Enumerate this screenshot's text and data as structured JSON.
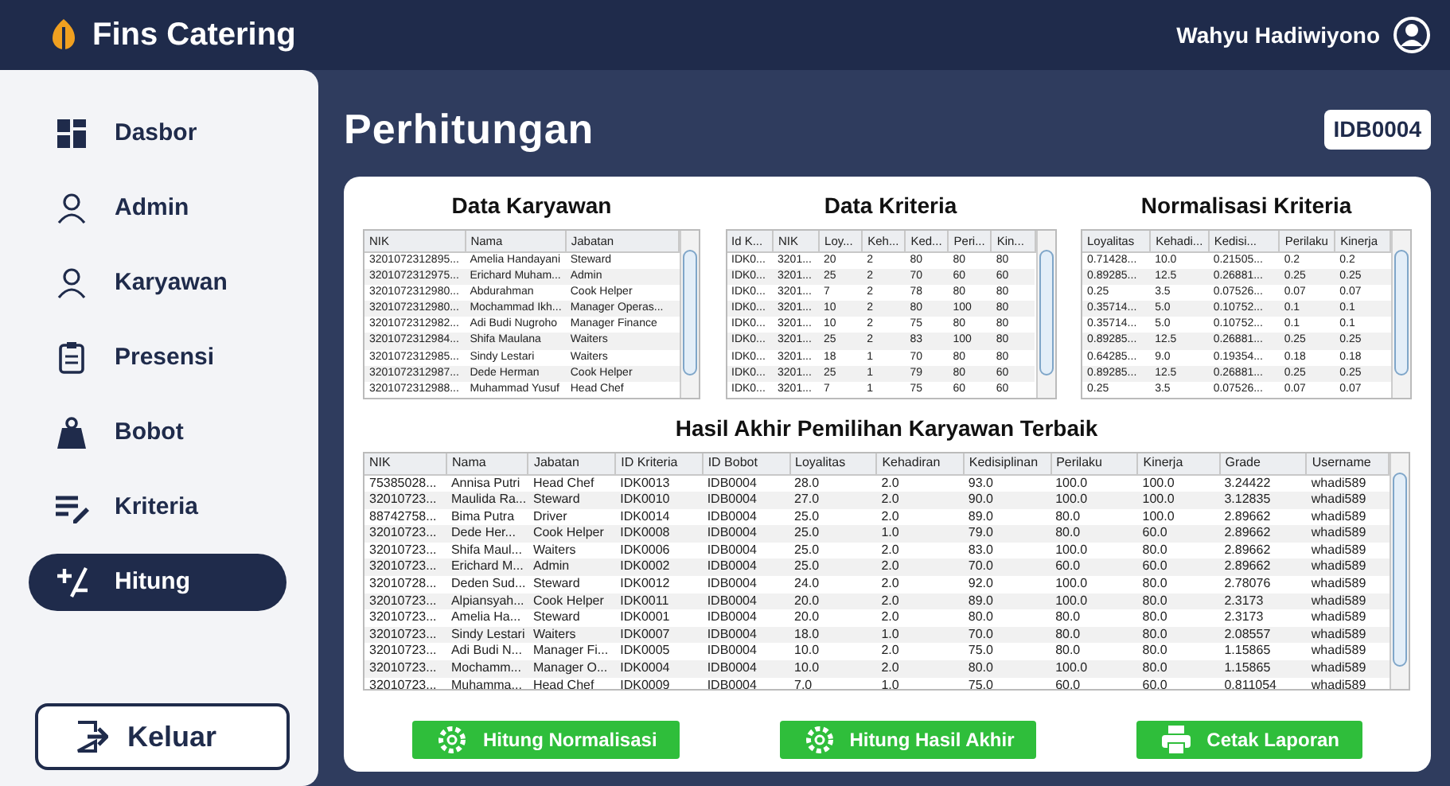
{
  "app": {
    "title": "Fins Catering",
    "user": "Wahyu Hadiwiyono"
  },
  "sidebar": {
    "items": [
      {
        "label": "Dasbor",
        "kind": "dashboard",
        "selected": false
      },
      {
        "label": "Admin",
        "kind": "person",
        "selected": false
      },
      {
        "label": "Karyawan",
        "kind": "person",
        "selected": false
      },
      {
        "label": "Presensi",
        "kind": "clipboard",
        "selected": false
      },
      {
        "label": "Bobot",
        "kind": "weight",
        "selected": false
      },
      {
        "label": "Kriteria",
        "kind": "edit",
        "selected": false
      },
      {
        "label": "Hitung",
        "kind": "calculate",
        "selected": true
      }
    ],
    "logout": "Keluar"
  },
  "page": {
    "title": "Perhitungan",
    "badge": "IDB0004"
  },
  "tables": [
    {
      "title": "Data Karyawan",
      "columns": [
        "NIK",
        "Nama",
        "Jabatan"
      ],
      "rows": [
        [
          "3201072312895...",
          "Amelia Handayani",
          "Steward"
        ],
        [
          "3201072312975...",
          "Erichard Muham...",
          "Admin"
        ],
        [
          "3201072312980...",
          "Abdurahman",
          "Cook Helper"
        ],
        [
          "3201072312980...",
          "Mochammad Ikh...",
          "Manager Operas..."
        ],
        [
          "3201072312982...",
          "Adi Budi Nugroho",
          "Manager Finance"
        ],
        [
          "3201072312984...",
          "Shifa Maulana",
          "Waiters"
        ],
        [
          "3201072312985...",
          "Sindy Lestari",
          "Waiters"
        ],
        [
          "3201072312987...",
          "Dede Herman",
          "Cook Helper"
        ],
        [
          "3201072312988...",
          "Muhammad Yusuf",
          "Head Chef"
        ]
      ]
    },
    {
      "title": "Data Kriteria",
      "columns": [
        "Id K...",
        "NIK",
        "Loy...",
        "Keh...",
        "Ked...",
        "Peri...",
        "Kin..."
      ],
      "rows": [
        [
          "IDK0...",
          "3201...",
          "20",
          "2",
          "80",
          "80",
          "80"
        ],
        [
          "IDK0...",
          "3201...",
          "25",
          "2",
          "70",
          "60",
          "60"
        ],
        [
          "IDK0...",
          "3201...",
          "7",
          "2",
          "78",
          "80",
          "80"
        ],
        [
          "IDK0...",
          "3201...",
          "10",
          "2",
          "80",
          "100",
          "80"
        ],
        [
          "IDK0...",
          "3201...",
          "10",
          "2",
          "75",
          "80",
          "80"
        ],
        [
          "IDK0...",
          "3201...",
          "25",
          "2",
          "83",
          "100",
          "80"
        ],
        [
          "IDK0...",
          "3201...",
          "18",
          "1",
          "70",
          "80",
          "80"
        ],
        [
          "IDK0...",
          "3201...",
          "25",
          "1",
          "79",
          "80",
          "60"
        ],
        [
          "IDK0...",
          "3201...",
          "7",
          "1",
          "75",
          "60",
          "60"
        ]
      ]
    },
    {
      "title": "Normalisasi Kriteria",
      "columns": [
        "Loyalitas",
        "Kehadi...",
        "Kedisi...",
        "Perilaku",
        "Kinerja"
      ],
      "rows": [
        [
          "0.71428...",
          "10.0",
          "0.21505...",
          "0.2",
          "0.2"
        ],
        [
          "0.89285...",
          "12.5",
          "0.26881...",
          "0.25",
          "0.25"
        ],
        [
          "0.25",
          "3.5",
          "0.07526...",
          "0.07",
          "0.07"
        ],
        [
          "0.35714...",
          "5.0",
          "0.10752...",
          "0.1",
          "0.1"
        ],
        [
          "0.35714...",
          "5.0",
          "0.10752...",
          "0.1",
          "0.1"
        ],
        [
          "0.89285...",
          "12.5",
          "0.26881...",
          "0.25",
          "0.25"
        ],
        [
          "0.64285...",
          "9.0",
          "0.19354...",
          "0.18",
          "0.18"
        ],
        [
          "0.89285...",
          "12.5",
          "0.26881...",
          "0.25",
          "0.25"
        ],
        [
          "0.25",
          "3.5",
          "0.07526...",
          "0.07",
          "0.07"
        ]
      ]
    },
    {
      "title": "Hasil Akhir Pemilihan Karyawan Terbaik",
      "columns": [
        "NIK",
        "Nama",
        "Jabatan",
        "ID Kriteria",
        "ID Bobot",
        "Loyalitas",
        "Kehadiran",
        "Kedisiplinan",
        "Perilaku",
        "Kinerja",
        "Grade",
        "Username"
      ],
      "rows": [
        [
          "75385028...",
          "Annisa Putri",
          "Head Chef",
          "IDK0013",
          "IDB0004",
          "28.0",
          "2.0",
          "93.0",
          "100.0",
          "100.0",
          "3.24422",
          "whadi589"
        ],
        [
          "32010723...",
          "Maulida Ra...",
          "Steward",
          "IDK0010",
          "IDB0004",
          "27.0",
          "2.0",
          "90.0",
          "100.0",
          "100.0",
          "3.12835",
          "whadi589"
        ],
        [
          "88742758...",
          "Bima Putra",
          "Driver",
          "IDK0014",
          "IDB0004",
          "25.0",
          "2.0",
          "89.0",
          "80.0",
          "100.0",
          "2.89662",
          "whadi589"
        ],
        [
          "32010723...",
          "Dede Her...",
          "Cook Helper",
          "IDK0008",
          "IDB0004",
          "25.0",
          "1.0",
          "79.0",
          "80.0",
          "60.0",
          "2.89662",
          "whadi589"
        ],
        [
          "32010723...",
          "Shifa Maul...",
          "Waiters",
          "IDK0006",
          "IDB0004",
          "25.0",
          "2.0",
          "83.0",
          "100.0",
          "80.0",
          "2.89662",
          "whadi589"
        ],
        [
          "32010723...",
          "Erichard M...",
          "Admin",
          "IDK0002",
          "IDB0004",
          "25.0",
          "2.0",
          "70.0",
          "60.0",
          "60.0",
          "2.89662",
          "whadi589"
        ],
        [
          "32010728...",
          "Deden Sud...",
          "Steward",
          "IDK0012",
          "IDB0004",
          "24.0",
          "2.0",
          "92.0",
          "100.0",
          "80.0",
          "2.78076",
          "whadi589"
        ],
        [
          "32010723...",
          "Alpiansyah...",
          "Cook Helper",
          "IDK0011",
          "IDB0004",
          "20.0",
          "2.0",
          "89.0",
          "100.0",
          "80.0",
          "2.3173",
          "whadi589"
        ],
        [
          "32010723...",
          "Amelia Ha...",
          "Steward",
          "IDK0001",
          "IDB0004",
          "20.0",
          "2.0",
          "80.0",
          "80.0",
          "80.0",
          "2.3173",
          "whadi589"
        ],
        [
          "32010723...",
          "Sindy Lestari",
          "Waiters",
          "IDK0007",
          "IDB0004",
          "18.0",
          "1.0",
          "70.0",
          "80.0",
          "80.0",
          "2.08557",
          "whadi589"
        ],
        [
          "32010723...",
          "Adi Budi N...",
          "Manager Fi...",
          "IDK0005",
          "IDB0004",
          "10.0",
          "2.0",
          "75.0",
          "80.0",
          "80.0",
          "1.15865",
          "whadi589"
        ],
        [
          "32010723...",
          "Mochamm...",
          "Manager O...",
          "IDK0004",
          "IDB0004",
          "10.0",
          "2.0",
          "80.0",
          "100.0",
          "80.0",
          "1.15865",
          "whadi589"
        ],
        [
          "32010723...",
          "Muhamma...",
          "Head Chef",
          "IDK0009",
          "IDB0004",
          "7.0",
          "1.0",
          "75.0",
          "60.0",
          "60.0",
          "0.811054",
          "whadi589"
        ]
      ]
    }
  ],
  "buttons": [
    {
      "label": "Hitung Normalisasi",
      "kind": "compute"
    },
    {
      "label": "Hitung Hasil Akhir",
      "kind": "compute"
    },
    {
      "label": "Cetak Laporan",
      "kind": "print"
    }
  ]
}
